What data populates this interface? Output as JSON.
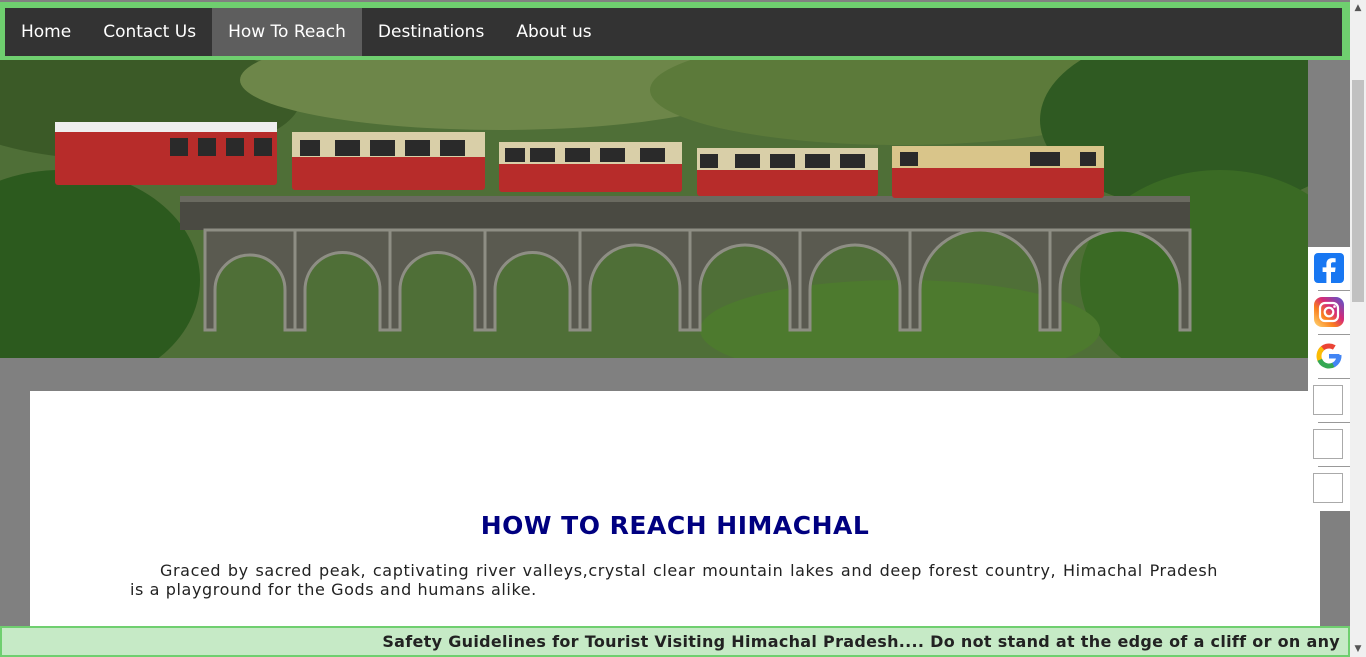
{
  "nav": {
    "items": [
      {
        "label": "Home"
      },
      {
        "label": "Contact Us"
      },
      {
        "label": "How To Reach",
        "active": true
      },
      {
        "label": "Destinations"
      },
      {
        "label": "About us"
      }
    ]
  },
  "hero": {
    "image": "toy-train-on-arched-bridge-photo"
  },
  "content": {
    "heading": "HOW TO REACH HIMACHAL",
    "paragraph1": "Graced by sacred peak, captivating river valleys,crystal clear mountain lakes and deep forest country, Himachal Pradesh is a playground for the Gods and humans alike."
  },
  "social": {
    "icons": [
      "facebook-icon",
      "instagram-icon",
      "google-icon",
      "broken-image-icon",
      "broken-image-icon",
      "broken-image-icon"
    ]
  },
  "marquee": {
    "text": "Safety Guidelines for Tourist Visiting Himachal Pradesh.... Do not stand at the edge of a cliff or on any"
  },
  "colors": {
    "nav_bg": "#333333",
    "nav_active": "#5e5e5e",
    "nav_border": "#6fcf6f",
    "heading": "#000080",
    "marquee_bg": "#c6eac6",
    "page_bg": "#808080"
  }
}
